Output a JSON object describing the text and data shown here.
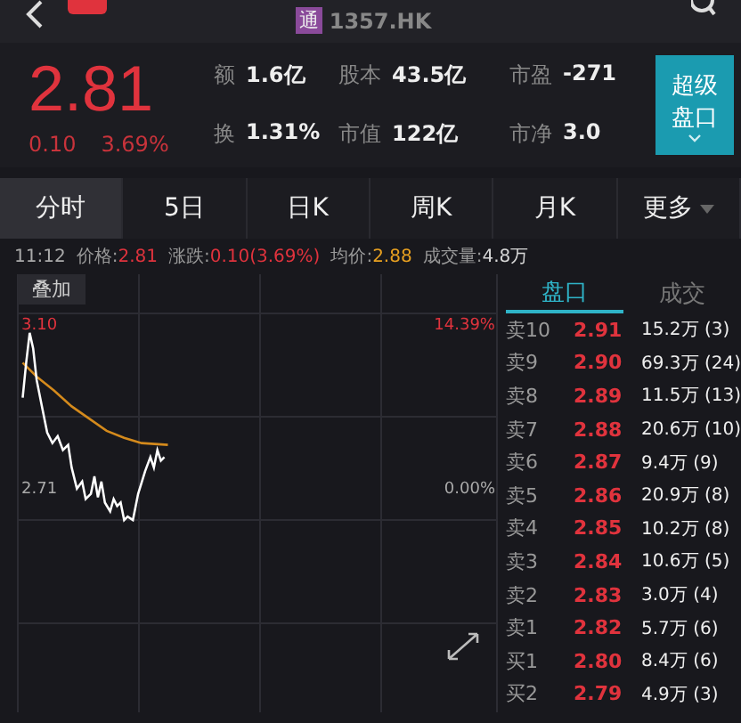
{
  "top_bar": {
    "badge": "通",
    "title": "1357.HK"
  },
  "quote": {
    "price": "2.81",
    "change": "0.10",
    "change_pct": "3.69%",
    "super_button": [
      "超级",
      "盘口"
    ],
    "stats": [
      {
        "label": "额",
        "value": "1.6亿"
      },
      {
        "label": "股本",
        "value": "43.5亿"
      },
      {
        "label": "市盈",
        "value": "-271"
      },
      {
        "label": "换",
        "value": "1.31%"
      },
      {
        "label": "市值",
        "value": "122亿"
      },
      {
        "label": "市净",
        "value": "3.0"
      }
    ]
  },
  "tabs": [
    {
      "label": "分时",
      "selected": true,
      "dropdown": false
    },
    {
      "label": "5日",
      "selected": false,
      "dropdown": false
    },
    {
      "label": "日K",
      "selected": false,
      "dropdown": false
    },
    {
      "label": "周K",
      "selected": false,
      "dropdown": false
    },
    {
      "label": "月K",
      "selected": false,
      "dropdown": false
    },
    {
      "label": "更多",
      "selected": false,
      "dropdown": true
    }
  ],
  "info_line": {
    "time": "11:12",
    "items": [
      {
        "label": "价格:",
        "value": "2.81",
        "color": "#e0333d"
      },
      {
        "label": "涨跌:",
        "value": "0.10(3.69%)",
        "color": "#e0333d"
      },
      {
        "label": "均价:",
        "value": "2.88",
        "color": "#e8a020"
      },
      {
        "label": "成交量:",
        "value": "4.8万",
        "color": "#d8d8d8"
      }
    ]
  },
  "chart": {
    "overlay_button": "叠加",
    "high": "3.10",
    "low": "2.71",
    "high_pct": "14.39%",
    "zero_pct": "0.00%"
  },
  "order_book": {
    "tabs": [
      {
        "label": "盘口",
        "selected": true
      },
      {
        "label": "成交",
        "selected": false
      }
    ],
    "rows": [
      {
        "label": "卖10",
        "price": "2.91",
        "volume": "15.2万 (3)"
      },
      {
        "label": "卖9",
        "price": "2.90",
        "volume": "69.3万 (24)"
      },
      {
        "label": "卖8",
        "price": "2.89",
        "volume": "11.5万 (13)"
      },
      {
        "label": "卖7",
        "price": "2.88",
        "volume": "20.6万 (10)"
      },
      {
        "label": "卖6",
        "price": "2.87",
        "volume": "9.4万 (9)"
      },
      {
        "label": "卖5",
        "price": "2.86",
        "volume": "20.9万 (8)"
      },
      {
        "label": "卖4",
        "price": "2.85",
        "volume": "10.2万 (8)"
      },
      {
        "label": "卖3",
        "price": "2.84",
        "volume": "10.6万 (5)"
      },
      {
        "label": "卖2",
        "price": "2.83",
        "volume": "3.0万 (4)"
      },
      {
        "label": "卖1",
        "price": "2.82",
        "volume": "5.7万 (6)"
      },
      {
        "label": "买1",
        "price": "2.80",
        "volume": "8.4万 (6)"
      },
      {
        "label": "买2",
        "price": "2.79",
        "volume": "4.9万 (3)"
      }
    ]
  }
}
